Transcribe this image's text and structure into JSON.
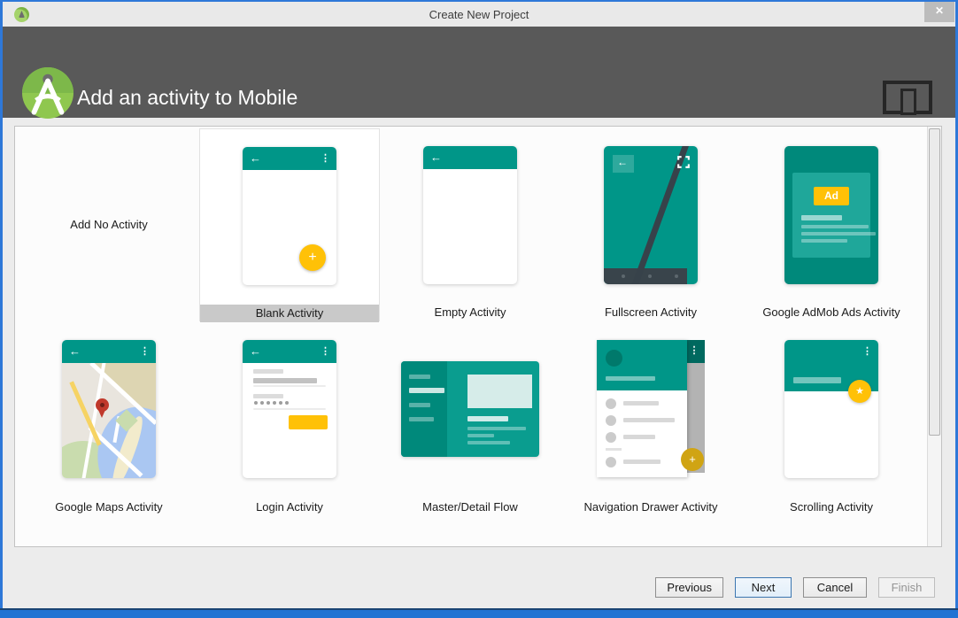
{
  "window": {
    "title": "Create New Project",
    "close_glyph": "✕"
  },
  "header": {
    "title": "Add an activity to Mobile"
  },
  "panel": {
    "selected": "Blank Activity",
    "activities": [
      {
        "label": "Add No Activity"
      },
      {
        "label": "Blank Activity"
      },
      {
        "label": "Empty Activity"
      },
      {
        "label": "Fullscreen Activity"
      },
      {
        "label": "Google AdMob Ads Activity",
        "badge": "Ad"
      },
      {
        "label": "Google Maps Activity"
      },
      {
        "label": "Login Activity"
      },
      {
        "label": "Master/Detail Flow"
      },
      {
        "label": "Navigation Drawer Activity"
      },
      {
        "label": "Scrolling Activity"
      }
    ]
  },
  "footer": {
    "buttons": [
      {
        "label": "Previous"
      },
      {
        "label": "Next"
      },
      {
        "label": "Cancel"
      },
      {
        "label": "Finish"
      }
    ]
  },
  "icons": {
    "back": "←",
    "overflow": "⋮",
    "plus": "+",
    "star": "★"
  },
  "colors": {
    "teal": "#009688",
    "teal_dark": "#00897b",
    "amber": "#FFC107",
    "header_bg": "#595959",
    "window_border": "#2E78D8",
    "selected_label_bg": "#C9C9C9"
  }
}
